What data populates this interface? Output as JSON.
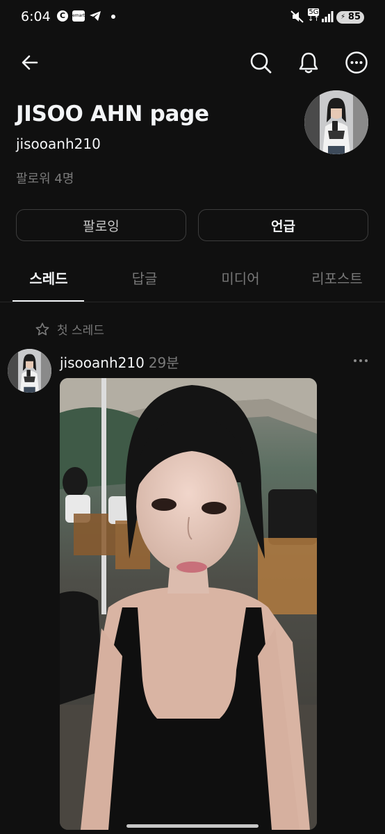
{
  "status_bar": {
    "time": "6:04",
    "network": "5G",
    "battery": "85"
  },
  "profile": {
    "name": "JISOO AHN page",
    "handle": "jisooanh210",
    "followers": "팔로워 4명"
  },
  "actions": {
    "following": "팔로잉",
    "mention": "언급"
  },
  "tabs": [
    {
      "label": "스레드",
      "active": true
    },
    {
      "label": "답글",
      "active": false
    },
    {
      "label": "미디어",
      "active": false
    },
    {
      "label": "리포스트",
      "active": false
    }
  ],
  "pinned": {
    "label": "첫 스레드"
  },
  "post": {
    "username": "jisooanh210",
    "time": "29분"
  },
  "icons": [
    "back-arrow-icon",
    "search-icon",
    "bell-icon",
    "more-icon",
    "star-icon",
    "ellipsis-icon"
  ]
}
